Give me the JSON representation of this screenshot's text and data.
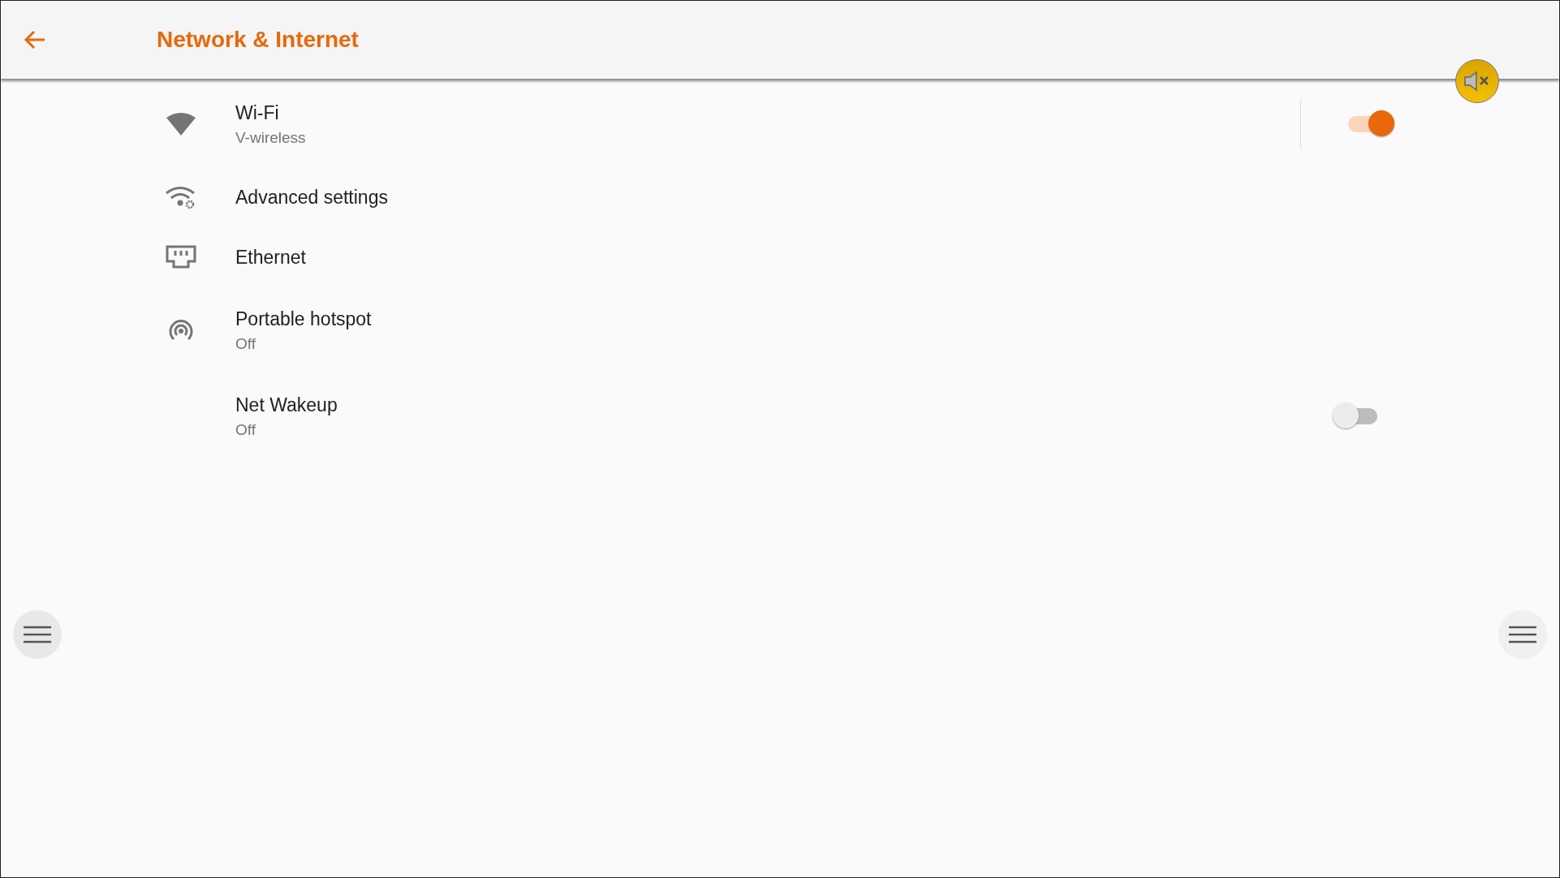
{
  "header": {
    "title": "Network & Internet"
  },
  "items": [
    {
      "kind": "wifi",
      "title": "Wi-Fi",
      "subtitle": "V-wireless",
      "switch": {
        "on": true
      }
    },
    {
      "kind": "advanced",
      "title": "Advanced settings"
    },
    {
      "kind": "ethernet",
      "title": "Ethernet"
    },
    {
      "kind": "hotspot",
      "title": "Portable hotspot",
      "subtitle": "Off"
    },
    {
      "kind": "none",
      "title": "Net Wakeup",
      "subtitle": "Off",
      "switch": {
        "on": false
      }
    }
  ],
  "mute_button": {
    "muted": true
  }
}
